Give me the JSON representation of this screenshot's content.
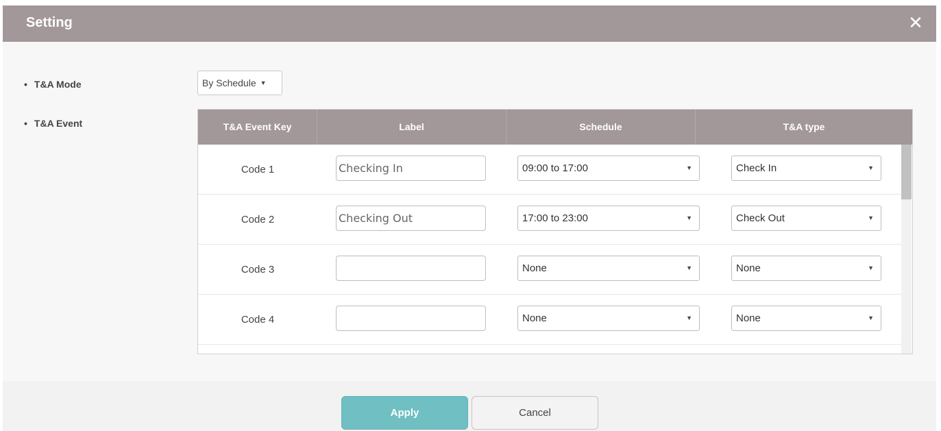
{
  "dialog": {
    "title": "Setting"
  },
  "fields": {
    "mode_label": "T&A Mode",
    "event_label": "T&A Event",
    "bullet": "•",
    "mode_value": "By Schedule",
    "caret": "▼"
  },
  "table": {
    "headers": [
      "T&A Event Key",
      "Label",
      "Schedule",
      "T&A type"
    ],
    "rows": [
      {
        "key": "Code 1",
        "label": "Checking In",
        "schedule": "09:00 to 17:00",
        "type": "Check In"
      },
      {
        "key": "Code 2",
        "label": "Checking Out",
        "schedule": "17:00 to 23:00",
        "type": "Check Out"
      },
      {
        "key": "Code 3",
        "label": "",
        "schedule": "None",
        "type": "None"
      },
      {
        "key": "Code 4",
        "label": "",
        "schedule": "None",
        "type": "None"
      }
    ]
  },
  "footer": {
    "apply_label": "Apply",
    "cancel_label": "Cancel"
  },
  "colors": {
    "header_bg": "#a29799",
    "apply_bg": "#6fbfc3"
  },
  "icons": {
    "close": "close-icon",
    "dropdown": "chevron-down-icon"
  }
}
